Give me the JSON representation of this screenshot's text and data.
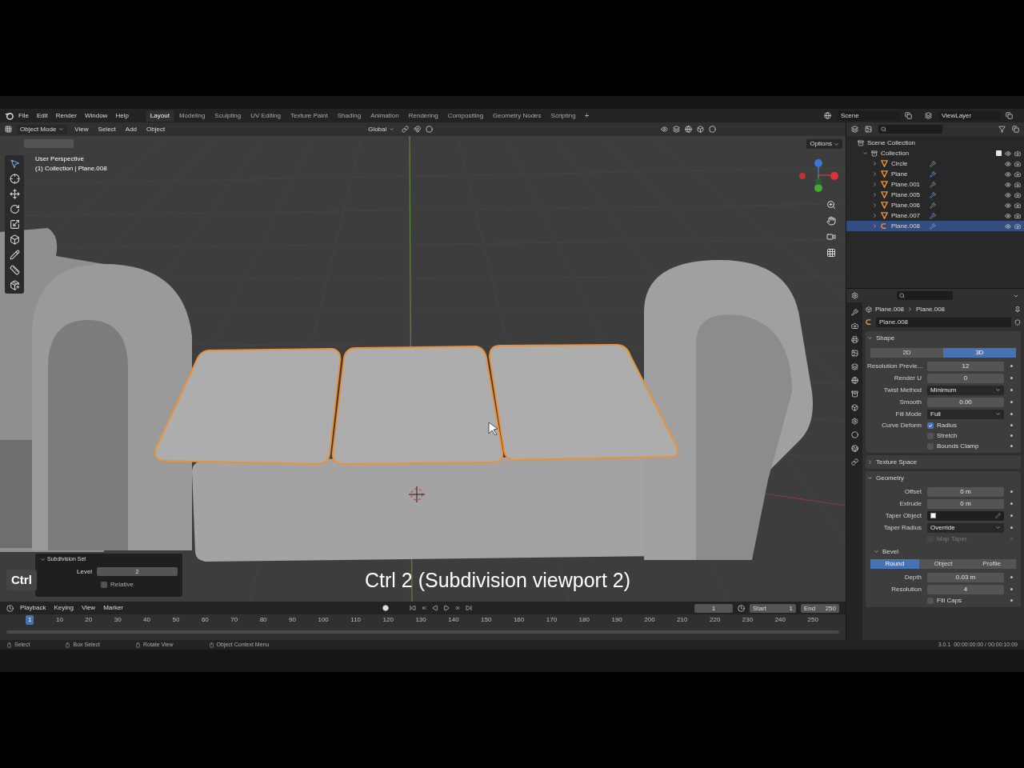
{
  "topbar": {
    "menus": [
      "File",
      "Edit",
      "Render",
      "Window",
      "Help"
    ],
    "workspaces": [
      {
        "label": "Layout",
        "selected": true
      },
      {
        "label": "Modeling",
        "selected": false
      },
      {
        "label": "Sculpting",
        "selected": false
      },
      {
        "label": "UV Editing",
        "selected": false
      },
      {
        "label": "Texture Paint",
        "selected": false
      },
      {
        "label": "Shading",
        "selected": false
      },
      {
        "label": "Animation",
        "selected": false
      },
      {
        "label": "Rendering",
        "selected": false
      },
      {
        "label": "Compositing",
        "selected": false
      },
      {
        "label": "Geometry Nodes",
        "selected": false
      },
      {
        "label": "Scripting",
        "selected": false
      }
    ],
    "add_tab": "+",
    "scene": "Scene",
    "view_layer": "ViewLayer"
  },
  "viewport": {
    "mode": "Object Mode",
    "menus": [
      "View",
      "Select",
      "Add",
      "Object"
    ],
    "orientation": "Global",
    "options": "Options",
    "overlay_title": "User Perspective",
    "overlay_subtitle": "(1) Collection | Plane.008",
    "key": "Ctrl",
    "caption": "Ctrl 2 (Subdivision viewport 2)",
    "operator_panel": {
      "title": "Subdivision Set",
      "level_label": "Level",
      "level": "2",
      "relative_label": "Relative",
      "relative": false
    }
  },
  "outliner": {
    "root": "Scene Collection",
    "collection": {
      "label": "Collection",
      "checked": true,
      "expanded": true,
      "children": [
        {
          "label": "Circle",
          "kind": "mesh",
          "selected": false
        },
        {
          "label": "Plane",
          "kind": "mesh",
          "selected": false
        },
        {
          "label": "Plane.001",
          "kind": "mesh",
          "selected": false
        },
        {
          "label": "Plane.005",
          "kind": "mesh",
          "selected": false
        },
        {
          "label": "Plane.006",
          "kind": "mesh",
          "selected": false
        },
        {
          "label": "Plane.007",
          "kind": "mesh",
          "selected": false
        },
        {
          "label": "Plane.008",
          "kind": "curve",
          "selected": true
        }
      ]
    }
  },
  "properties": {
    "breadcrumb": [
      "Plane.008",
      "Plane.008"
    ],
    "data_name": "Plane.008",
    "sections": [
      {
        "title": "Shape",
        "expanded": true,
        "segments": [
          {
            "label": "2D",
            "selected": false
          },
          {
            "label": "3D",
            "selected": true
          }
        ],
        "rows": [
          {
            "kind": "number",
            "label": "Resolution Previe...",
            "value": "12"
          },
          {
            "kind": "number",
            "label": "Render U",
            "value": "0"
          },
          {
            "kind": "dropdown",
            "label": "Twist Method",
            "value": "Minimum"
          },
          {
            "kind": "number",
            "label": "Smooth",
            "value": "0.00"
          },
          {
            "kind": "dropdown",
            "label": "Fill Mode",
            "value": "Full"
          },
          {
            "kind": "checkbox",
            "label": "Curve Deform",
            "text": "Radius",
            "checked": true,
            "disabled": false
          },
          {
            "kind": "checkbox",
            "text": "Stretch",
            "checked": false,
            "disabled": false
          },
          {
            "kind": "checkbox",
            "text": "Bounds Clamp",
            "checked": false,
            "disabled": false
          }
        ]
      },
      {
        "title": "Texture Space",
        "expanded": false
      },
      {
        "title": "Geometry",
        "expanded": true,
        "rows": [
          {
            "kind": "number",
            "label": "Offset",
            "value": "0 m"
          },
          {
            "kind": "number",
            "label": "Extrude",
            "value": "0 m"
          },
          {
            "kind": "object",
            "label": "Taper Object"
          },
          {
            "kind": "dropdown",
            "label": "Taper Radius",
            "value": "Override"
          },
          {
            "kind": "checkbox",
            "text": "Map Taper",
            "checked": false,
            "disabled": true
          }
        ],
        "subsection": {
          "title": "Bevel",
          "expanded": true,
          "segments": [
            {
              "label": "Round",
              "selected": true
            },
            {
              "label": "Object",
              "selected": false
            },
            {
              "label": "Profile",
              "selected": false
            }
          ],
          "rows": [
            {
              "kind": "number",
              "label": "Depth",
              "value": "0.03 m"
            },
            {
              "kind": "number",
              "label": "Resolution",
              "value": "4"
            },
            {
              "kind": "checkbox",
              "text": "Fill Caps",
              "checked": false,
              "disabled": false
            }
          ]
        }
      }
    ]
  },
  "timeline": {
    "menus": [
      "Playback",
      "Keying",
      "View",
      "Marker"
    ],
    "current_frame": "1",
    "start_label": "Start",
    "start": "1",
    "end_label": "End",
    "end": "250",
    "ticks": [
      {
        "label": "1",
        "selected": true
      },
      {
        "label": "10",
        "selected": false
      },
      {
        "label": "20",
        "selected": false
      },
      {
        "label": "30",
        "selected": false
      },
      {
        "label": "40",
        "selected": false
      },
      {
        "label": "50",
        "selected": false
      },
      {
        "label": "60",
        "selected": false
      },
      {
        "label": "70",
        "selected": false
      },
      {
        "label": "80",
        "selected": false
      },
      {
        "label": "90",
        "selected": false
      },
      {
        "label": "100",
        "selected": false
      },
      {
        "label": "110",
        "selected": false
      },
      {
        "label": "120",
        "selected": false
      },
      {
        "label": "130",
        "selected": false
      },
      {
        "label": "140",
        "selected": false
      },
      {
        "label": "150",
        "selected": false
      },
      {
        "label": "160",
        "selected": false
      },
      {
        "label": "170",
        "selected": false
      },
      {
        "label": "180",
        "selected": false
      },
      {
        "label": "190",
        "selected": false
      },
      {
        "label": "200",
        "selected": false
      },
      {
        "label": "210",
        "selected": false
      },
      {
        "label": "220",
        "selected": false
      },
      {
        "label": "230",
        "selected": false
      },
      {
        "label": "240",
        "selected": false
      },
      {
        "label": "250",
        "selected": false
      }
    ]
  },
  "status_bar": {
    "items": [
      "Select",
      "Box Select",
      "Rotate View",
      "Object Context Menu"
    ],
    "version": "3.0.1  00:00:00:00 / 00:00:10:09"
  }
}
